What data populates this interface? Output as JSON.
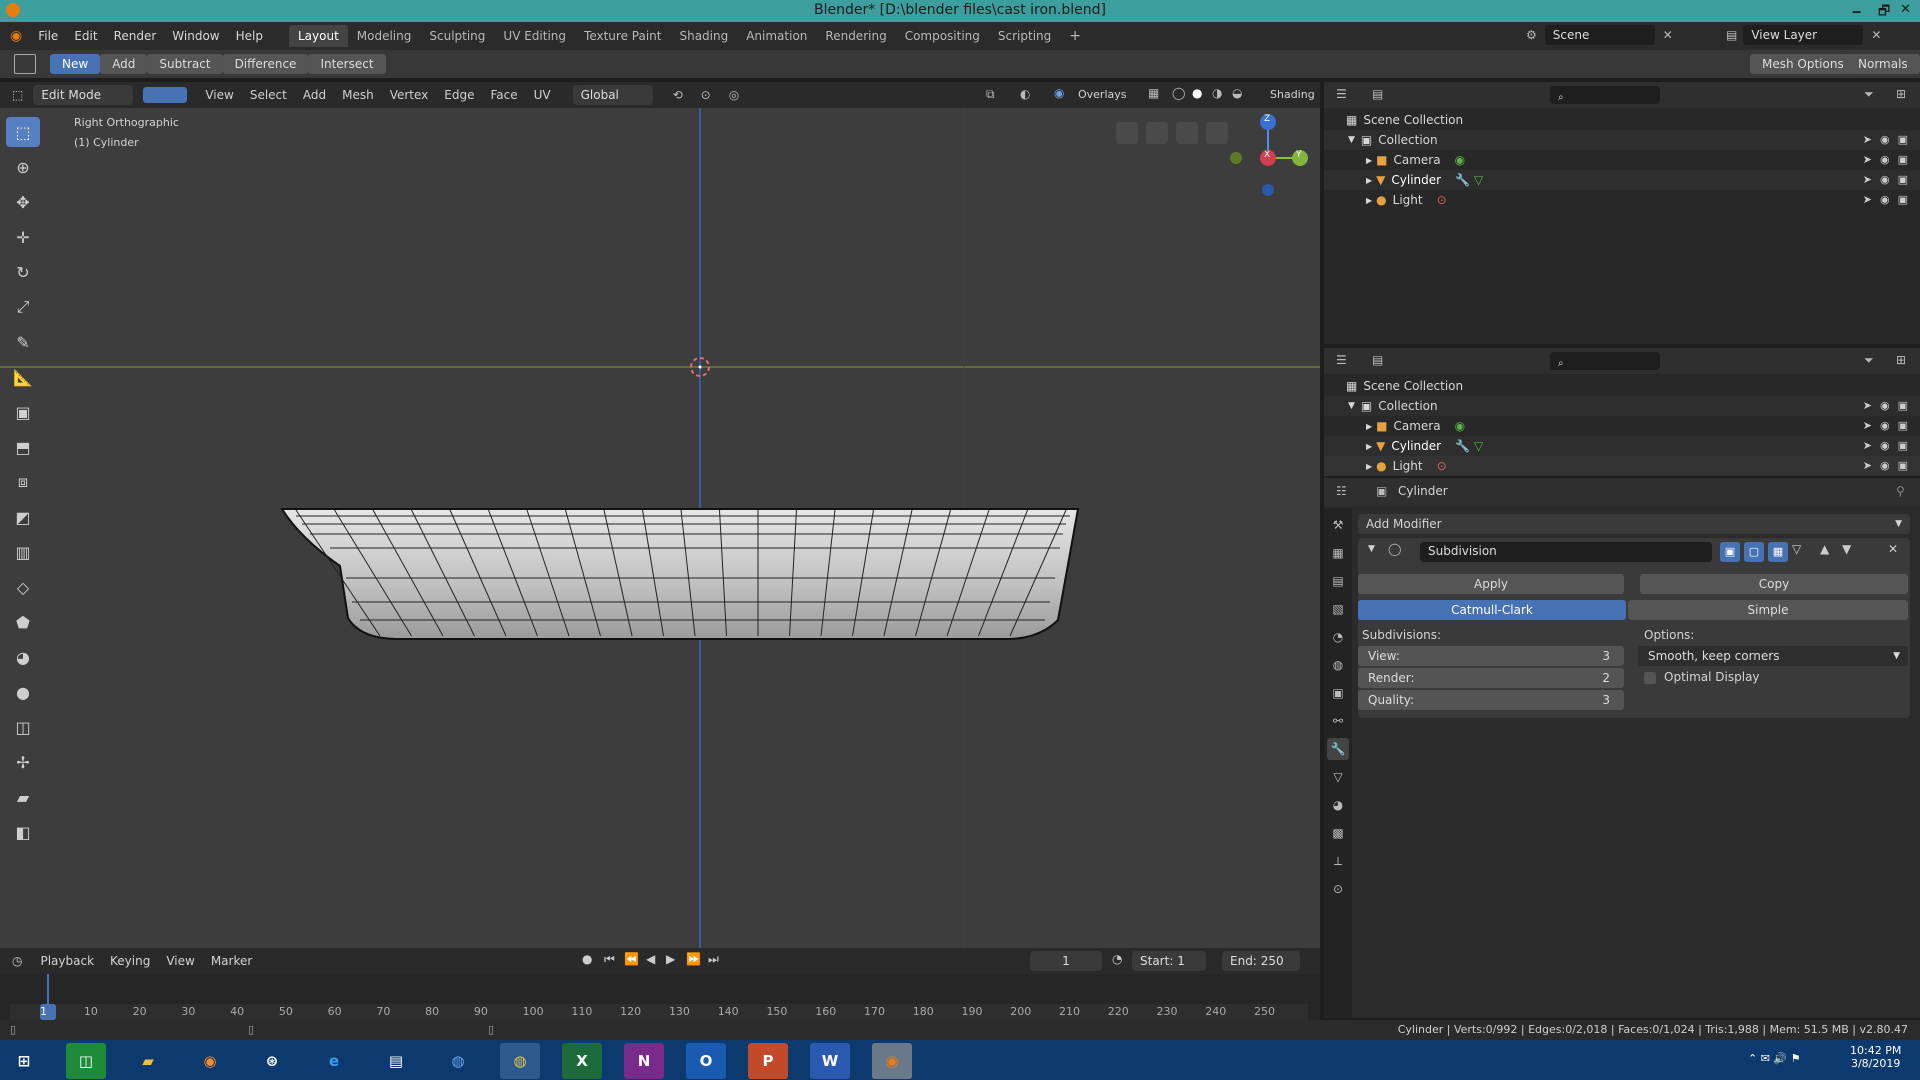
{
  "window": {
    "title": "Blender* [D:\\blender files\\cast iron.blend]",
    "minimize": "🗕",
    "restore": "🗗",
    "close": "✕"
  },
  "menu": [
    "File",
    "Edit",
    "Render",
    "Window",
    "Help"
  ],
  "workspaces": [
    "Layout",
    "Modeling",
    "Sculpting",
    "UV Editing",
    "Texture Paint",
    "Shading",
    "Animation",
    "Rendering",
    "Compositing",
    "Scripting"
  ],
  "scene": {
    "label": "Scene",
    "view_layer": "View Layer"
  },
  "toolheader": {
    "modes": [
      "New",
      "Add",
      "Subtract",
      "Difference",
      "Intersect"
    ],
    "mesh_options": "Mesh Options",
    "normals": "Normals"
  },
  "viewport_header": {
    "mode": "Edit Mode",
    "menus": [
      "View",
      "Select",
      "Add",
      "Mesh",
      "Vertex",
      "Edge",
      "Face",
      "UV"
    ],
    "orientation": "Global",
    "overlays": "Overlays",
    "shading": "Shading"
  },
  "viewport": {
    "view_name": "Right Orthographic",
    "object_name": "(1) Cylinder",
    "gizmo": {
      "z": "Z",
      "y": "Y",
      "x": "X"
    }
  },
  "outliner": {
    "scene_collection": "Scene Collection",
    "collection": "Collection",
    "items": [
      "Camera",
      "Cylinder",
      "Light"
    ]
  },
  "properties": {
    "object": "Cylinder",
    "add_modifier": "Add Modifier",
    "modifier_name": "Subdivision",
    "apply": "Apply",
    "copy": "Copy",
    "catmull": "Catmull-Clark",
    "simple": "Simple",
    "subdivisions_label": "Subdivisions:",
    "options_label": "Options:",
    "view_label": "View:",
    "view_value": "3",
    "render_label": "Render:",
    "render_value": "2",
    "quality_label": "Quality:",
    "quality_value": "3",
    "uv_mode": "Smooth, keep corners",
    "optimal_display": "Optimal Display"
  },
  "timeline": {
    "menus": [
      "Playback",
      "Keying",
      "View",
      "Marker"
    ],
    "current_frame": "1",
    "start_label": "Start:",
    "start_value": "1",
    "end_label": "End:",
    "end_value": "250",
    "ticks": [
      "1",
      "10",
      "20",
      "30",
      "40",
      "50",
      "60",
      "70",
      "80",
      "90",
      "100",
      "110",
      "120",
      "130",
      "140",
      "150",
      "160",
      "170",
      "180",
      "190",
      "200",
      "210",
      "220",
      "230",
      "240",
      "250"
    ]
  },
  "status": "Cylinder | Verts:0/992 | Edges:0/2,018 | Faces:0/1,024 | Tris:1,988 | Mem: 51.5 MB | v2.80.47",
  "taskbar": {
    "apps": [
      "windows-start",
      "store",
      "file-explorer",
      "firefox",
      "steam",
      "internet-explorer",
      "notepad",
      "chrome-alt",
      "chrome",
      "excel",
      "onenote",
      "outlook",
      "powerpoint",
      "word",
      "blender"
    ],
    "time": "10:42 PM",
    "date": "3/8/2019"
  },
  "colors": {
    "accent": "#4772b3",
    "titlebar": "#3d9e9e",
    "taskbar": "#0d3a6e"
  }
}
